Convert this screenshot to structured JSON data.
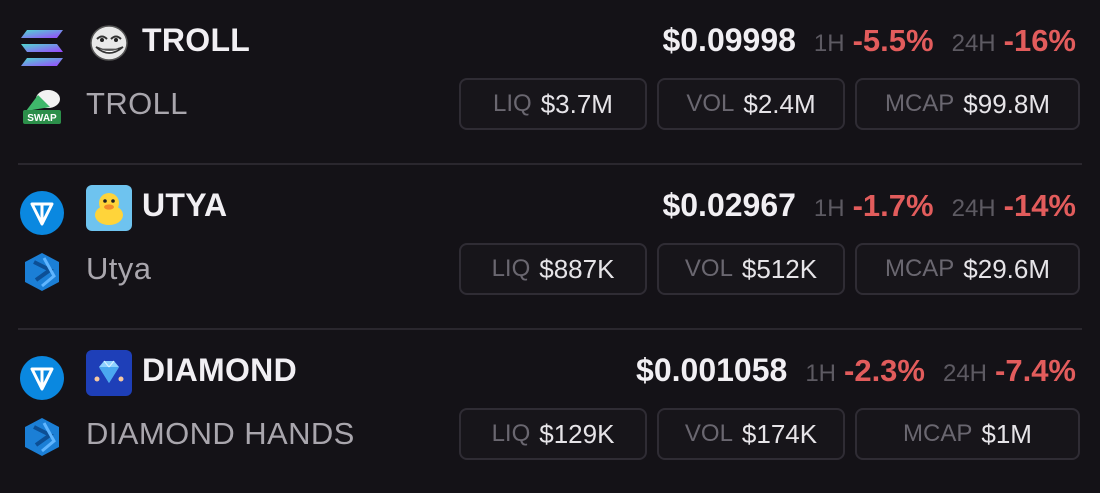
{
  "tokens": [
    {
      "chain": "solana",
      "chain_icon": "solana-icon",
      "token_icon": "troll-face-icon",
      "dex_icon": "swap-icon",
      "dex_badge_text": "SWAP",
      "symbol": "TROLL",
      "name": "TROLL",
      "price": "$0.09998",
      "change_1h_label": "1H",
      "change_1h": "-5.5%",
      "change_24h_label": "24H",
      "change_24h": "-16%",
      "liq_label": "LIQ",
      "liq": "$3.7M",
      "vol_label": "VOL",
      "vol": "$2.4M",
      "mcap_label": "MCAP",
      "mcap": "$99.8M"
    },
    {
      "chain": "ton",
      "chain_icon": "ton-icon",
      "token_icon": "duck-icon",
      "dex_icon": "stonfi-icon",
      "symbol": "UTYA",
      "name": "Utya",
      "price": "$0.02967",
      "change_1h_label": "1H",
      "change_1h": "-1.7%",
      "change_24h_label": "24H",
      "change_24h": "-14%",
      "liq_label": "LIQ",
      "liq": "$887K",
      "vol_label": "VOL",
      "vol": "$512K",
      "mcap_label": "MCAP",
      "mcap": "$29.6M"
    },
    {
      "chain": "ton",
      "chain_icon": "ton-icon",
      "token_icon": "diamond-icon",
      "dex_icon": "stonfi-icon",
      "symbol": "DIAMOND",
      "name": "DIAMOND HANDS",
      "price": "$0.001058",
      "change_1h_label": "1H",
      "change_1h": "-2.3%",
      "change_24h_label": "24H",
      "change_24h": "-7.4%",
      "liq_label": "LIQ",
      "liq": "$129K",
      "vol_label": "VOL",
      "vol": "$174K",
      "mcap_label": "MCAP",
      "mcap": "$1M"
    }
  ],
  "colors": {
    "background": "#141217",
    "negative": "#e25c5c",
    "ton_blue": "#0a88e0",
    "stonfi_blue": "#1b7fd6"
  }
}
